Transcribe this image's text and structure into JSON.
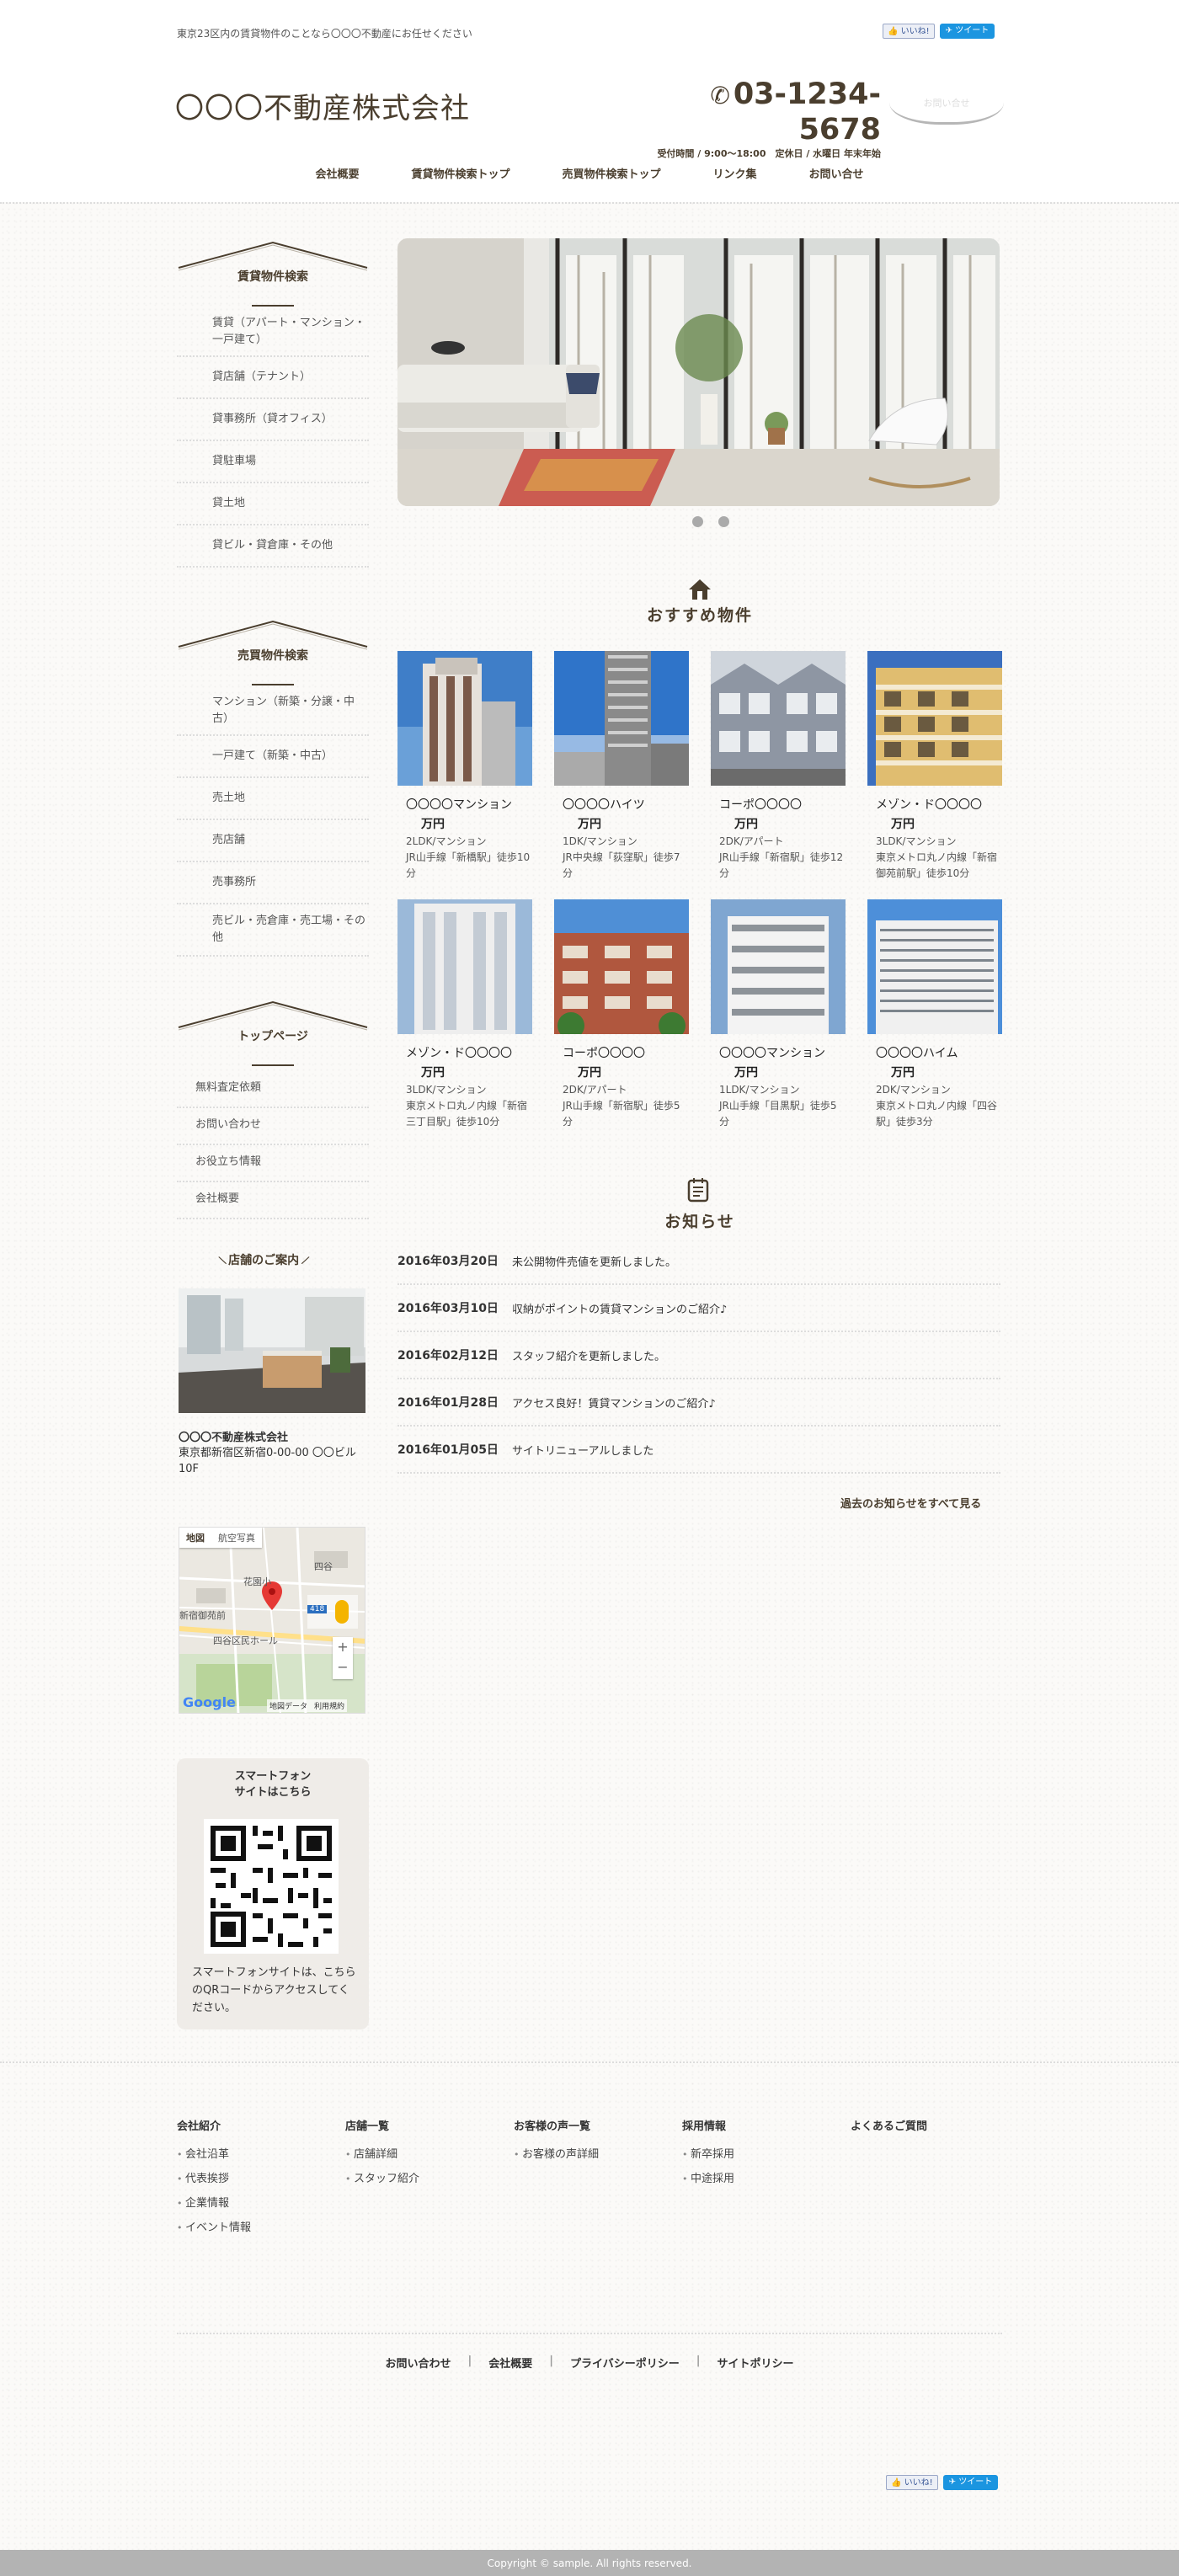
{
  "header": {
    "tagline": "東京23区内の賃貸物件のことなら〇〇〇不動産にお任せください",
    "like": "いいね!",
    "tweet": "ツイート",
    "logo": "〇〇〇不動産株式会社",
    "phone": "03-1234-5678",
    "hours": "受付時間 / 9:00～18:00　定休日 / 水曜日 年末年始",
    "contact_badge": "お問い合せ"
  },
  "nav": [
    "会社概要",
    "賃貸物件検索トップ",
    "売買物件検索トップ",
    "リンク集",
    "お問い合せ"
  ],
  "sidebar": {
    "rent_title": "賃貸物件検索",
    "rent_items": [
      "賃貸（アパート・マンション・一戸建て）",
      "貸店舗（テナント）",
      "貸事務所（貸オフィス）",
      "貸駐車場",
      "貸土地",
      "貸ビル・貸倉庫・その他"
    ],
    "sale_title": "売買物件検索",
    "sale_items": [
      "マンション（新築・分譲・中古）",
      "一戸建て（新築・中古）",
      "売土地",
      "売店舗",
      "売事務所",
      "売ビル・売倉庫・売工場・その他"
    ],
    "top_title": "トップページ",
    "top_items": [
      "無料査定依頼",
      "お問い合わせ",
      "お役立ち情報",
      "会社概要"
    ],
    "shop_title": "店舗のご案内",
    "shop_name": "〇〇〇不動産株式会社",
    "shop_address": "東京都新宿区新宿0-00-00 〇〇ビル10F",
    "map": {
      "tab1": "地図",
      "tab2": "航空写真",
      "place": "四谷区民ホール",
      "place2": "花園小",
      "google": "Google",
      "map_data": "地図データ",
      "terms": "利用規約",
      "zoom_in": "+",
      "zoom_out": "−",
      "route": "418",
      "station": "新宿御苑前"
    },
    "sp_title": "スマートフォン\nサイトはこちら",
    "sp_text": "スマートフォンサイトは、こちらのQRコードからアクセスしてください。"
  },
  "recommend": {
    "title": "おすすめ物件",
    "items": [
      {
        "name": "〇〇〇〇マンション",
        "price": "万円",
        "spec": "2LDK/マンション",
        "access": "JR山手線「新橋駅」徒歩10分"
      },
      {
        "name": "〇〇〇〇ハイツ",
        "price": "万円",
        "spec": "1DK/マンション",
        "access": "JR中央線「荻窪駅」徒歩7分"
      },
      {
        "name": "コーポ〇〇〇〇",
        "price": "万円",
        "spec": "2DK/アパート",
        "access": "JR山手線「新宿駅」徒歩12分"
      },
      {
        "name": "メゾン・ド〇〇〇〇",
        "price": "万円",
        "spec": "3LDK/マンション",
        "access": "東京メトロ丸ノ内線「新宿御苑前駅」徒歩10分"
      },
      {
        "name": "メゾン・ド〇〇〇〇",
        "price": "万円",
        "spec": "3LDK/マンション",
        "access": "東京メトロ丸ノ内線「新宿三丁目駅」徒歩10分"
      },
      {
        "name": "コーポ〇〇〇〇",
        "price": "万円",
        "spec": "2DK/アパート",
        "access": "JR山手線「新宿駅」徒歩5分"
      },
      {
        "name": "〇〇〇〇マンション",
        "price": "万円",
        "spec": "1LDK/マンション",
        "access": "JR山手線「目黒駅」徒歩5分"
      },
      {
        "name": "〇〇〇〇ハイム",
        "price": "万円",
        "spec": "2DK/マンション",
        "access": "東京メトロ丸ノ内線「四谷駅」徒歩3分"
      }
    ]
  },
  "news": {
    "title": "お知らせ",
    "items": [
      {
        "date": "2016年03月20日",
        "text": "未公開物件売値を更新しました。"
      },
      {
        "date": "2016年03月10日",
        "text": "収納がポイントの賃貸マンションのご紹介♪"
      },
      {
        "date": "2016年02月12日",
        "text": "スタッフ紹介を更新しました。"
      },
      {
        "date": "2016年01月28日",
        "text": "アクセス良好！賃貸マンションのご紹介♪"
      },
      {
        "date": "2016年01月05日",
        "text": "サイトリニューアルしました"
      }
    ],
    "more": "過去のお知らせをすべて見る"
  },
  "footer": {
    "cols": [
      {
        "title": "会社紹介",
        "links": [
          "会社沿革",
          "代表挨拶",
          "企業情報",
          "イベント情報"
        ]
      },
      {
        "title": "店舗一覧",
        "links": [
          "店舗詳細",
          "スタッフ紹介"
        ]
      },
      {
        "title": "お客様の声一覧",
        "links": [
          "お客様の声詳細"
        ]
      },
      {
        "title": "採用情報",
        "links": [
          "新卒採用",
          "中途採用"
        ]
      },
      {
        "title": "よくあるご質問",
        "links": []
      }
    ],
    "nav": [
      "お問い合わせ",
      "会社概要",
      "プライバシーポリシー",
      "サイトポリシー"
    ],
    "copyright": "Copyright © sample. All rights reserved."
  },
  "colors": {
    "brand": "#4a3e2e",
    "accent": "#1b95e0",
    "footer_bar": "#b3b3b3"
  }
}
